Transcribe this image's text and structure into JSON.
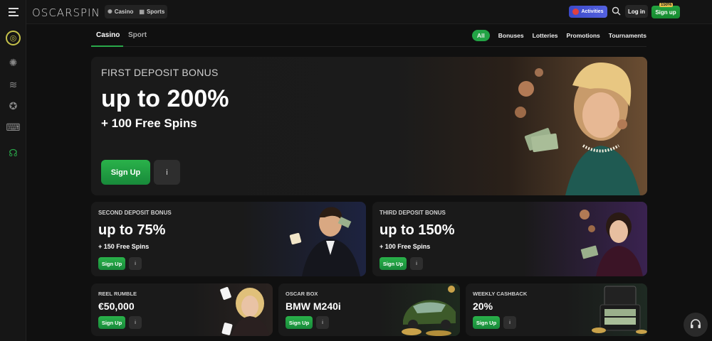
{
  "brand": "OSCARSPIN",
  "topnav": {
    "casino": "Casino",
    "sports": "Sports"
  },
  "header": {
    "activities": "Activities",
    "login": "Log in",
    "signup": "Sign up",
    "signup_badge": "150%"
  },
  "tabs": {
    "casino": "Casino",
    "sport": "Sport"
  },
  "filters": [
    "All",
    "Bonuses",
    "Lotteries",
    "Promotions",
    "Tournaments"
  ],
  "hero": {
    "tag": "FIRST DEPOSIT BONUS",
    "big": "up to 200%",
    "sub": "+ 100 Free Spins",
    "cta": "Sign Up",
    "info": "i"
  },
  "second": {
    "tag": "SECOND DEPOSIT BONUS",
    "big": "up to 75%",
    "sub": "+ 150 Free Spins",
    "cta": "Sign Up",
    "info": "i"
  },
  "third": {
    "tag": "THIRD DEPOSIT BONUS",
    "big": "up to 150%",
    "sub": "+ 100 Free Spins",
    "cta": "Sign Up",
    "info": "i"
  },
  "reel": {
    "tag": "REEL RUMBLE",
    "big": "€50,000",
    "cta": "Sign Up",
    "info": "i"
  },
  "oscar": {
    "tag": "OSCAR BOX",
    "big": "BMW M240i",
    "cta": "Sign Up",
    "info": "i"
  },
  "cashback": {
    "tag": "WEEKLY CASHBACK",
    "big": "20%",
    "cta": "Sign Up",
    "info": "i"
  },
  "colors": {
    "accent_green": "#22a345",
    "activities_blue": "#3b49c8",
    "badge_gold": "#e8c04a"
  }
}
